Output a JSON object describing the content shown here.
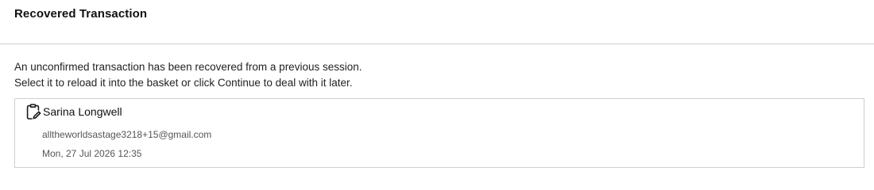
{
  "dialog": {
    "title": "Recovered Transaction",
    "message_line1": "An unconfirmed transaction has been recovered from a previous session.",
    "message_line2": "Select it to reload it into the basket or click Continue to deal with it later."
  },
  "recovered_item": {
    "icon": "clipboard-edit-icon",
    "name": "Sarina Longwell",
    "email": "alltheworldsastage3218+15@gmail.com",
    "datetime": "Mon, 27 Jul 2026 12:35"
  }
}
